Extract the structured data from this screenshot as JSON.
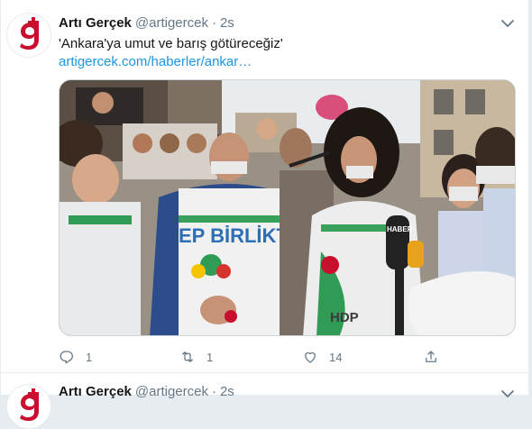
{
  "tweets": [
    {
      "author": {
        "name": "Artı Gerçek",
        "handle": "@artigercek"
      },
      "separator": "·",
      "time": "2s",
      "text": "'Ankara'ya umut ve barış götüreceğiz'",
      "link": "artigercek.com/haberler/ankar…",
      "media": {
        "banner_text": "EP BİRLİKT",
        "logo_text": "HDP",
        "mic_text": "HABER"
      },
      "actions": {
        "replies": "1",
        "retweets": "1",
        "likes": "14"
      }
    },
    {
      "author": {
        "name": "Artı Gerçek",
        "handle": "@artigercek"
      },
      "separator": "·",
      "time": "2s"
    }
  ],
  "colors": {
    "brand": "#c8102e",
    "link": "#1b95e0",
    "muted": "#657786",
    "border": "#e6ecf0"
  },
  "icons": [
    "reply-icon",
    "retweet-icon",
    "like-icon",
    "share-icon",
    "chevron-down-icon"
  ]
}
